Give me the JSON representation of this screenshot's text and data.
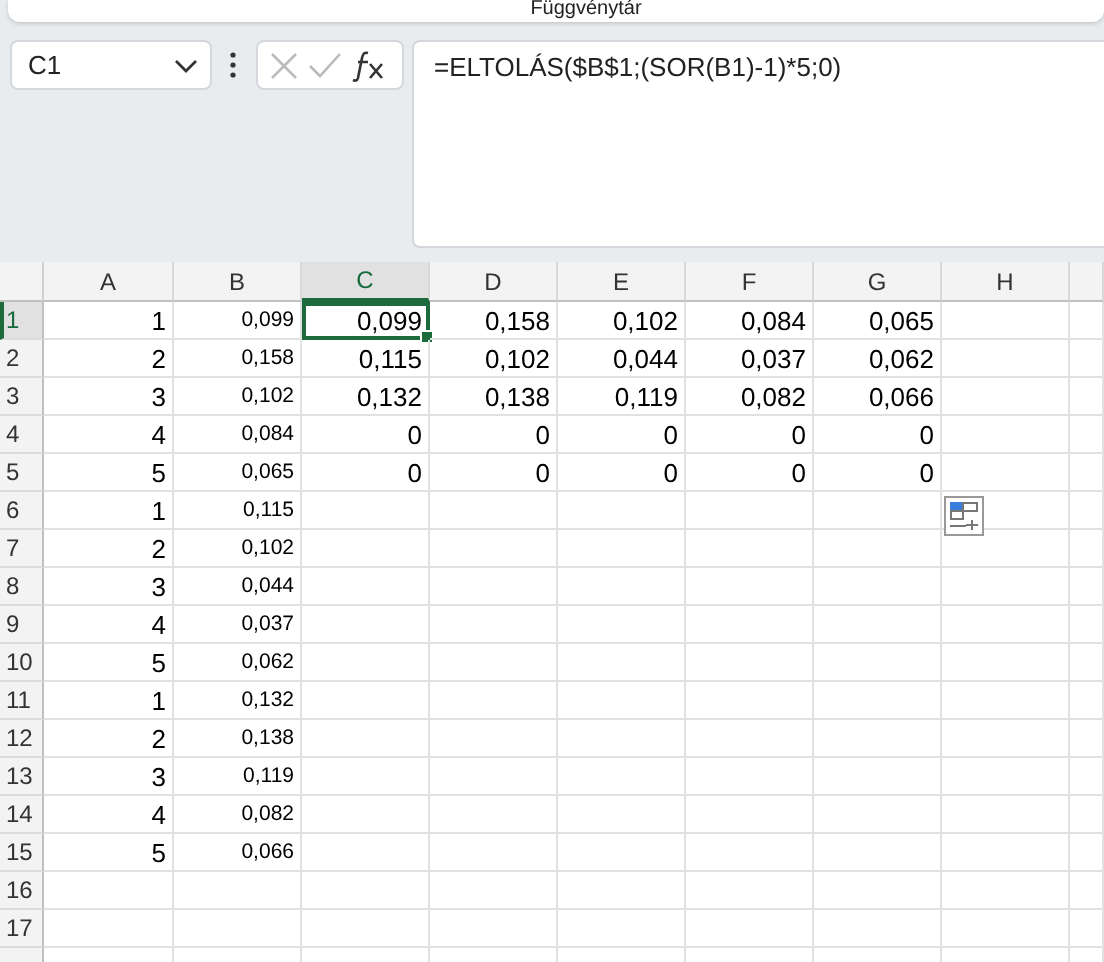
{
  "ribbon": {
    "group_label": "Függvénytár"
  },
  "formula_bar": {
    "name_box": "C1",
    "formula": "=ELTOLÁS($B$1;(SOR(B1)-1)*5;0)"
  },
  "sheet": {
    "columns": [
      {
        "label": "A",
        "selected": false,
        "kind": "normal"
      },
      {
        "label": "B",
        "selected": false,
        "kind": "compact"
      },
      {
        "label": "C",
        "selected": true,
        "kind": "normal"
      },
      {
        "label": "D",
        "selected": false,
        "kind": "normal"
      },
      {
        "label": "E",
        "selected": false,
        "kind": "normal"
      },
      {
        "label": "F",
        "selected": false,
        "kind": "normal"
      },
      {
        "label": "G",
        "selected": false,
        "kind": "normal"
      },
      {
        "label": "H",
        "selected": false,
        "kind": "normal"
      }
    ],
    "rows": [
      {
        "header": "1",
        "selected": true,
        "cells": [
          {
            "value": "1",
            "selected": false
          },
          {
            "value": "0,099",
            "selected": false
          },
          {
            "value": "0,099",
            "selected": true
          },
          {
            "value": "0,158",
            "selected": false
          },
          {
            "value": "0,102",
            "selected": false
          },
          {
            "value": "0,084",
            "selected": false
          },
          {
            "value": "0,065",
            "selected": false
          }
        ]
      },
      {
        "header": "2",
        "selected": false,
        "cells": [
          {
            "value": "2",
            "selected": false
          },
          {
            "value": "0,158",
            "selected": false
          },
          {
            "value": "0,115",
            "selected": false
          },
          {
            "value": "0,102",
            "selected": false
          },
          {
            "value": "0,044",
            "selected": false
          },
          {
            "value": "0,037",
            "selected": false
          },
          {
            "value": "0,062",
            "selected": false
          }
        ]
      },
      {
        "header": "3",
        "selected": false,
        "cells": [
          {
            "value": "3",
            "selected": false
          },
          {
            "value": "0,102",
            "selected": false
          },
          {
            "value": "0,132",
            "selected": false
          },
          {
            "value": "0,138",
            "selected": false
          },
          {
            "value": "0,119",
            "selected": false
          },
          {
            "value": "0,082",
            "selected": false
          },
          {
            "value": "0,066",
            "selected": false
          }
        ]
      },
      {
        "header": "4",
        "selected": false,
        "cells": [
          {
            "value": "4",
            "selected": false
          },
          {
            "value": "0,084",
            "selected": false
          },
          {
            "value": "0",
            "selected": false
          },
          {
            "value": "0",
            "selected": false
          },
          {
            "value": "0",
            "selected": false
          },
          {
            "value": "0",
            "selected": false
          },
          {
            "value": "0",
            "selected": false
          }
        ]
      },
      {
        "header": "5",
        "selected": false,
        "cells": [
          {
            "value": "5",
            "selected": false
          },
          {
            "value": "0,065",
            "selected": false
          },
          {
            "value": "0",
            "selected": false
          },
          {
            "value": "0",
            "selected": false
          },
          {
            "value": "0",
            "selected": false
          },
          {
            "value": "0",
            "selected": false
          },
          {
            "value": "0",
            "selected": false
          }
        ]
      },
      {
        "header": "6",
        "selected": false,
        "cells": [
          {
            "value": "1",
            "selected": false
          },
          {
            "value": "0,115",
            "selected": false
          }
        ]
      },
      {
        "header": "7",
        "selected": false,
        "cells": [
          {
            "value": "2",
            "selected": false
          },
          {
            "value": "0,102",
            "selected": false
          }
        ]
      },
      {
        "header": "8",
        "selected": false,
        "cells": [
          {
            "value": "3",
            "selected": false
          },
          {
            "value": "0,044",
            "selected": false
          }
        ]
      },
      {
        "header": "9",
        "selected": false,
        "cells": [
          {
            "value": "4",
            "selected": false
          },
          {
            "value": "0,037",
            "selected": false
          }
        ]
      },
      {
        "header": "10",
        "selected": false,
        "cells": [
          {
            "value": "5",
            "selected": false
          },
          {
            "value": "0,062",
            "selected": false
          }
        ]
      },
      {
        "header": "11",
        "selected": false,
        "cells": [
          {
            "value": "1",
            "selected": false
          },
          {
            "value": "0,132",
            "selected": false
          }
        ]
      },
      {
        "header": "12",
        "selected": false,
        "cells": [
          {
            "value": "2",
            "selected": false
          },
          {
            "value": "0,138",
            "selected": false
          }
        ]
      },
      {
        "header": "13",
        "selected": false,
        "cells": [
          {
            "value": "3",
            "selected": false
          },
          {
            "value": "0,119",
            "selected": false
          }
        ]
      },
      {
        "header": "14",
        "selected": false,
        "cells": [
          {
            "value": "4",
            "selected": false
          },
          {
            "value": "0,082",
            "selected": false
          }
        ]
      },
      {
        "header": "15",
        "selected": false,
        "cells": [
          {
            "value": "5",
            "selected": false
          },
          {
            "value": "0,066",
            "selected": false
          }
        ]
      },
      {
        "header": "16",
        "selected": false,
        "cells": []
      },
      {
        "header": "17",
        "selected": false,
        "cells": []
      }
    ]
  }
}
